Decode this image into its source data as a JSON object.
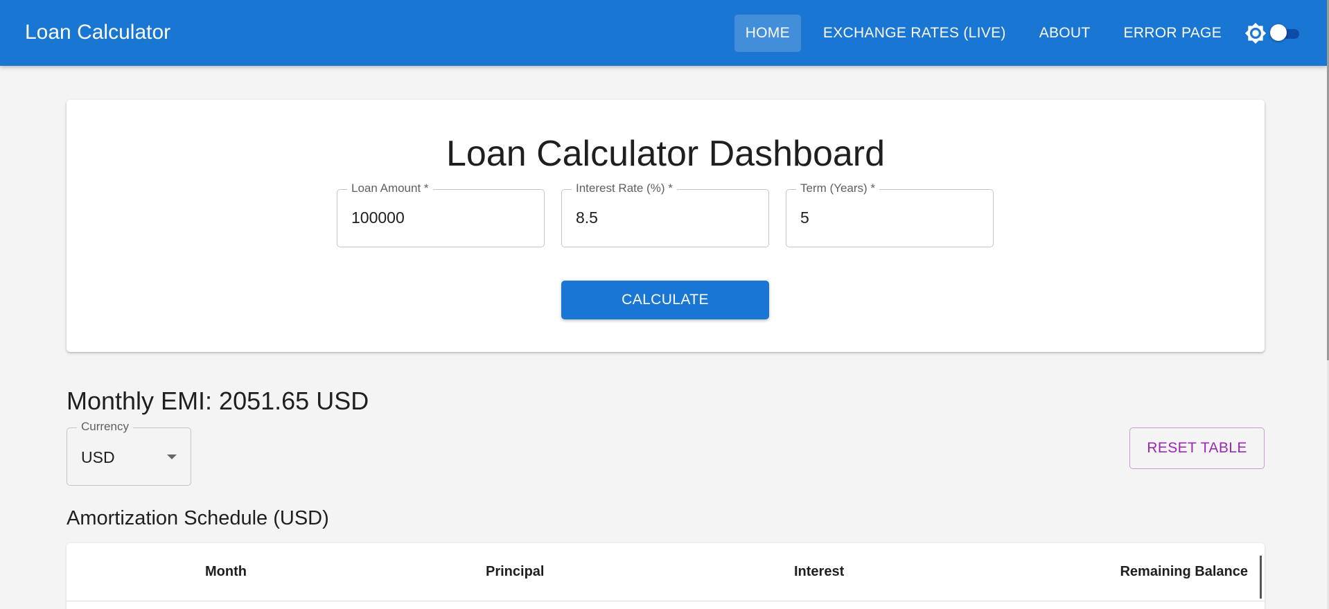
{
  "app": {
    "title": "Loan Calculator"
  },
  "nav": {
    "items": [
      {
        "label": "HOME",
        "active": true
      },
      {
        "label": "EXCHANGE RATES (LIVE)",
        "active": false
      },
      {
        "label": "ABOUT",
        "active": false
      },
      {
        "label": "ERROR PAGE",
        "active": false
      }
    ],
    "theme_icon": "sun-gear-icon",
    "dark_mode_toggle": false
  },
  "dashboard": {
    "title": "Loan Calculator Dashboard",
    "fields": {
      "loan_amount": {
        "label": "Loan Amount *",
        "value": "100000"
      },
      "interest_rate": {
        "label": "Interest Rate (%) *",
        "value": "8.5"
      },
      "term_years": {
        "label": "Term (Years) *",
        "value": "5"
      }
    },
    "calculate_label": "CALCULATE"
  },
  "results": {
    "emi_text": "Monthly EMI: 2051.65 USD",
    "currency": {
      "label": "Currency",
      "value": "USD"
    },
    "reset_label": "RESET TABLE",
    "amortization_title": "Amortization Schedule (USD)",
    "table": {
      "columns": [
        "Month",
        "Principal",
        "Interest",
        "Remaining Balance"
      ]
    }
  },
  "colors": {
    "primary": "#1976d2",
    "secondary": "#9c27b0",
    "background": "#f4f4f4"
  }
}
